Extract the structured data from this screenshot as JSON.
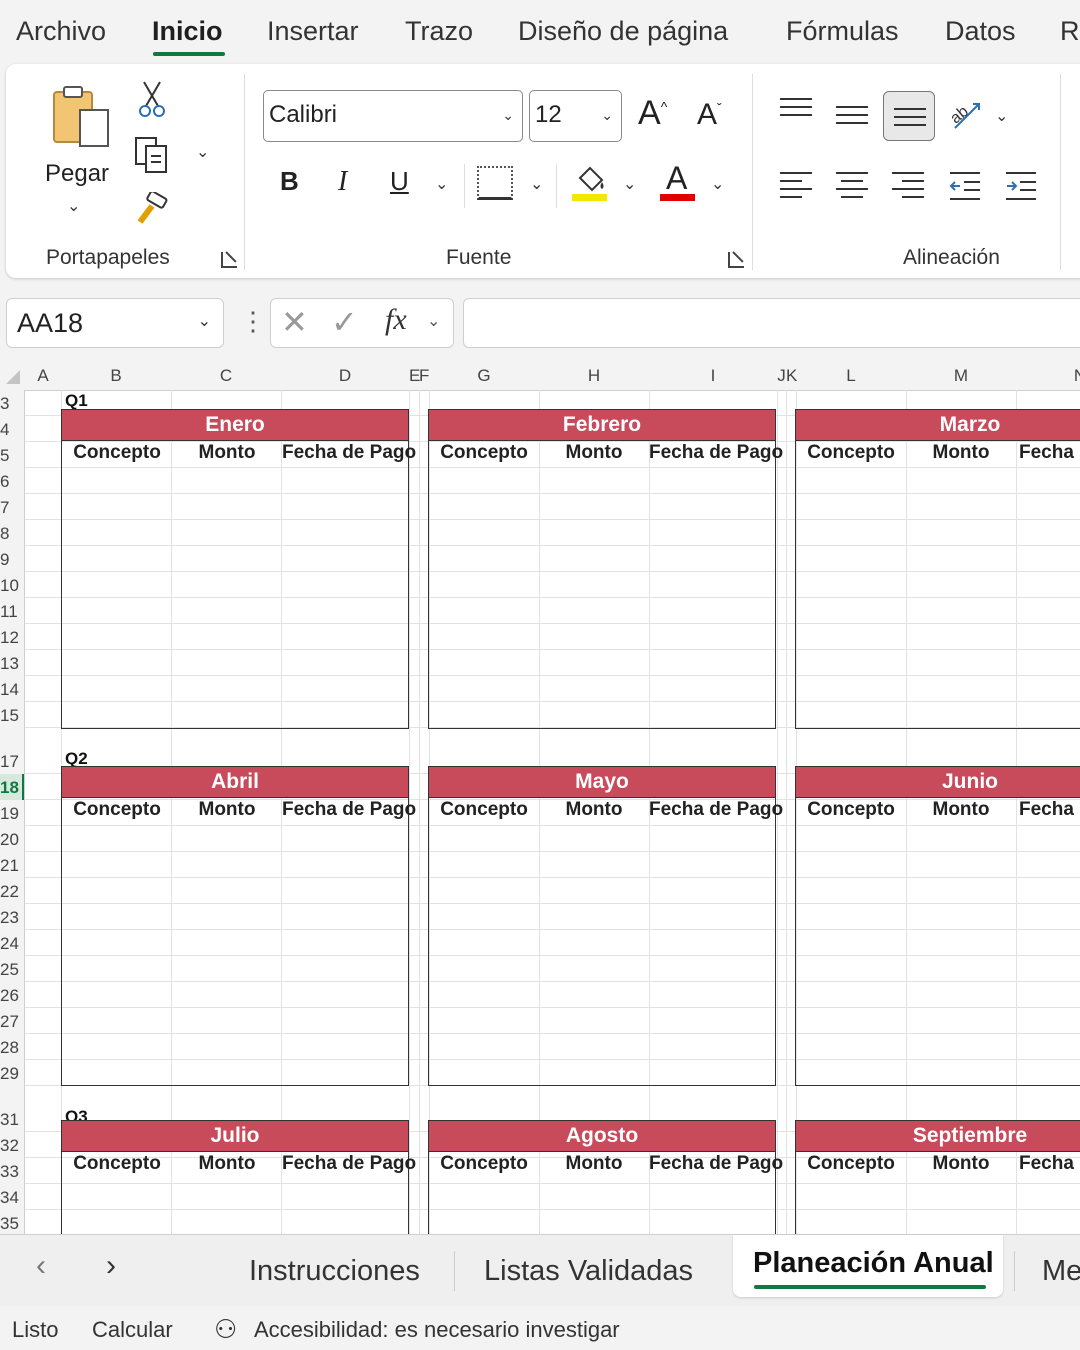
{
  "menu": {
    "tabs": [
      "Archivo",
      "Inicio",
      "Insertar",
      "Trazo",
      "Diseño de página",
      "Fórmulas",
      "Datos",
      "Re"
    ]
  },
  "ribbon": {
    "clipboard": {
      "paste_label": "Pegar",
      "group_label": "Portapapeles"
    },
    "font": {
      "font_name": "Calibri",
      "font_size": "12",
      "group_label": "Fuente",
      "bold": "B",
      "italic": "I",
      "underline": "U",
      "font_color_glyph": "A",
      "highlight_color": "#f5e600",
      "font_color": "#e00000"
    },
    "alignment": {
      "group_label": "Alineación"
    }
  },
  "formula_bar": {
    "name_box": "AA18",
    "fx_label": "fx",
    "formula": ""
  },
  "columns": [
    "A",
    "B",
    "C",
    "D",
    "E",
    "F",
    "G",
    "H",
    "I",
    "J",
    "K",
    "L",
    "M",
    "N"
  ],
  "rows": [
    "3",
    "4",
    "5",
    "6",
    "7",
    "8",
    "9",
    "10",
    "11",
    "12",
    "13",
    "14",
    "15",
    "17",
    "18",
    "19",
    "20",
    "21",
    "22",
    "23",
    "24",
    "25",
    "26",
    "27",
    "28",
    "29",
    "31",
    "32",
    "33",
    "34",
    "35"
  ],
  "selected_row": "18",
  "quarters": [
    "Q1",
    "Q2",
    "Q3"
  ],
  "months": [
    "Enero",
    "Febrero",
    "Marzo",
    "Abril",
    "Mayo",
    "Junio",
    "Julio",
    "Agosto",
    "Septiembre"
  ],
  "subheaders": [
    "Concepto",
    "Monto",
    "Fecha de Pago"
  ],
  "subheader_cut": "Fecha d",
  "colors": {
    "month_header": "#c84b5c",
    "accent_green": "#0e7a3f"
  },
  "sheet_tabs": [
    "Instrucciones",
    "Listas Validadas",
    "Planeación Anual",
    "Me"
  ],
  "active_sheet": "Planeación Anual",
  "status": {
    "ready": "Listo",
    "calculate": "Calcular",
    "accessibility": "Accesibilidad: es necesario investigar"
  }
}
